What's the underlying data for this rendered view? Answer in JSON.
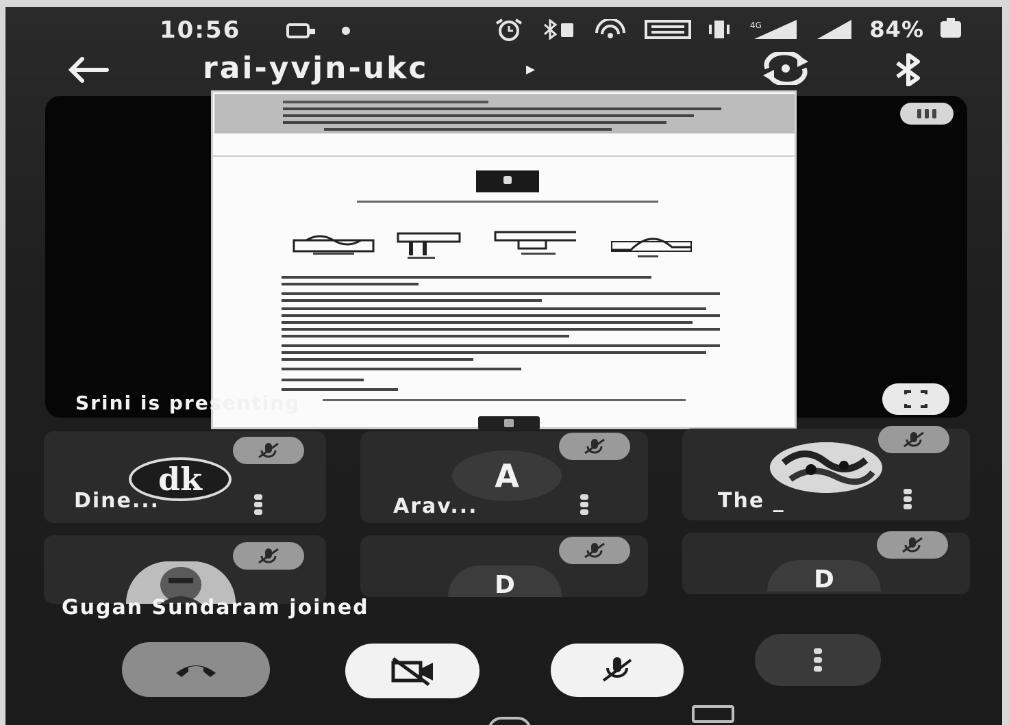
{
  "status_bar": {
    "time": "10:56",
    "battery_percent": "84%",
    "icons": [
      "cast-icon",
      "dot-icon",
      "alarm-icon",
      "bluetooth-battery-icon",
      "hotspot-icon",
      "volte-icon",
      "vibrate-icon",
      "signal-4g-icon",
      "signal-icon",
      "battery-icon"
    ]
  },
  "toolbar": {
    "title": "rai-yvjn-ukc",
    "title_caret": "▸",
    "back_icon": "arrow-left-icon",
    "switch_camera_icon": "switch-camera-icon",
    "audio_icon": "bluetooth-icon"
  },
  "presentation": {
    "presenter_label": "Srini is presenting",
    "fullscreen_icon": "fullscreen-icon",
    "overflow_icon": "more-options-icon"
  },
  "participants": [
    {
      "label": "Dine...",
      "avatar_text": "dk",
      "muted": true
    },
    {
      "label": "Arav...",
      "avatar_text": "A",
      "muted": true
    },
    {
      "label": "The _",
      "avatar_text": "",
      "muted": true
    },
    {
      "label": "",
      "avatar_text": "",
      "muted": true
    },
    {
      "label": "",
      "avatar_text": "D",
      "muted": true
    },
    {
      "label": "",
      "avatar_text": "D",
      "muted": true
    }
  ],
  "toast": {
    "message": "Gugan Sundaram joined"
  },
  "controls": {
    "end_call_icon": "end-call-icon",
    "camera_icon": "camera-off-icon",
    "mic_icon": "mic-off-icon",
    "more_icon": "more-vert-icon"
  },
  "colors": {
    "background": "#1f1f1f",
    "tile": "#2b2b2b",
    "end_call": "#8c8c8c",
    "control_light": "#f2f2f2"
  }
}
